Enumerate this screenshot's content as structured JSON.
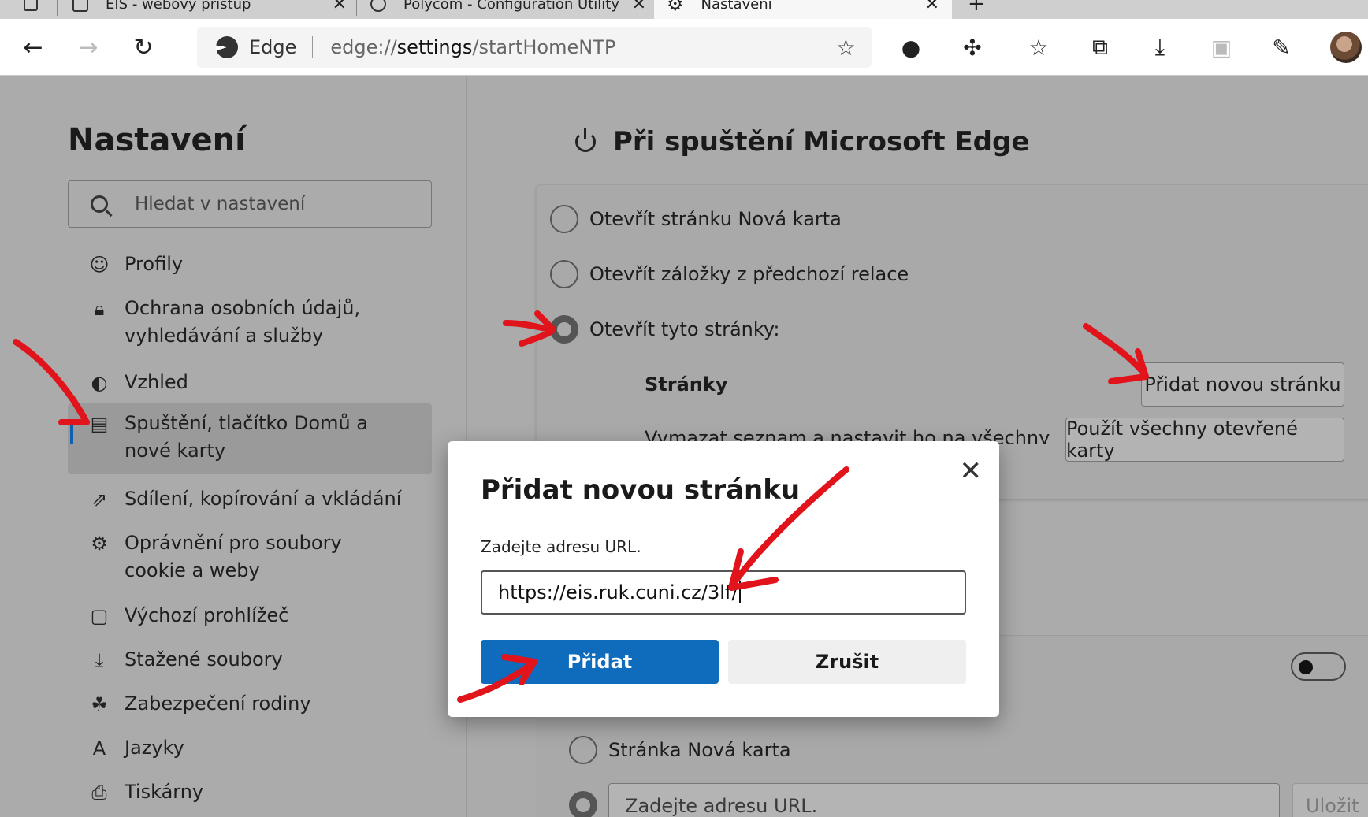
{
  "browser": {
    "tabs": [
      {
        "title": "EIS - webový přístup"
      },
      {
        "title": "Polycom - Configuration Utility"
      },
      {
        "title": "Nastavení"
      }
    ],
    "omnibox": {
      "brand": "Edge",
      "url_prefix": "edge://",
      "url_host": "settings",
      "url_path": "/startHomeNTP"
    }
  },
  "sidebar": {
    "title": "Nastavení",
    "search_placeholder": "Hledat v nastavení",
    "items": [
      {
        "label": "Profily",
        "icon": "profile-icon"
      },
      {
        "label": "Ochrana osobních údajů, vyhledávání a služby",
        "icon": "lock-icon"
      },
      {
        "label": "Vzhled",
        "icon": "palette-icon"
      },
      {
        "label": "Spuštění, tlačítko Domů a nové karty",
        "icon": "start-icon",
        "selected": true
      },
      {
        "label": "Sdílení, kopírování a vkládání",
        "icon": "share-icon"
      },
      {
        "label": "Oprávnění pro soubory cookie a weby",
        "icon": "cookie-settings-icon"
      },
      {
        "label": "Výchozí prohlížeč",
        "icon": "default-browser-icon"
      },
      {
        "label": "Stažené soubory",
        "icon": "download-icon"
      },
      {
        "label": "Zabezpečení rodiny",
        "icon": "family-icon"
      },
      {
        "label": "Jazyky",
        "icon": "language-icon"
      },
      {
        "label": "Tiskárny",
        "icon": "printer-icon"
      }
    ]
  },
  "main": {
    "title": "Při spuštění Microsoft Edge",
    "options": [
      {
        "label": "Otevřít stránku Nová karta",
        "checked": false
      },
      {
        "label": "Otevřít záložky z předchozí relace",
        "checked": false
      },
      {
        "label": "Otevřít tyto stránky:",
        "checked": true
      }
    ],
    "pages_label": "Stránky",
    "add_page_button": "Přidat novou stránku",
    "clear_label": "Vymazat seznam a nastavit ho na všechny",
    "use_all_tabs_button": "Použít všechny otevřené karty",
    "new_tab_option": "Stránka Nová karta",
    "url_placeholder": "Zadejte adresu URL.",
    "save_button": "Uložit"
  },
  "dialog": {
    "title": "Přidat novou stránku",
    "label": "Zadejte adresu URL.",
    "input_value": "https://eis.ruk.cuni.cz/3lf/",
    "add_button": "Přidat",
    "cancel_button": "Zrušit"
  },
  "colors": {
    "accent": "#0f6cbd",
    "annotation": "#e0141a"
  }
}
